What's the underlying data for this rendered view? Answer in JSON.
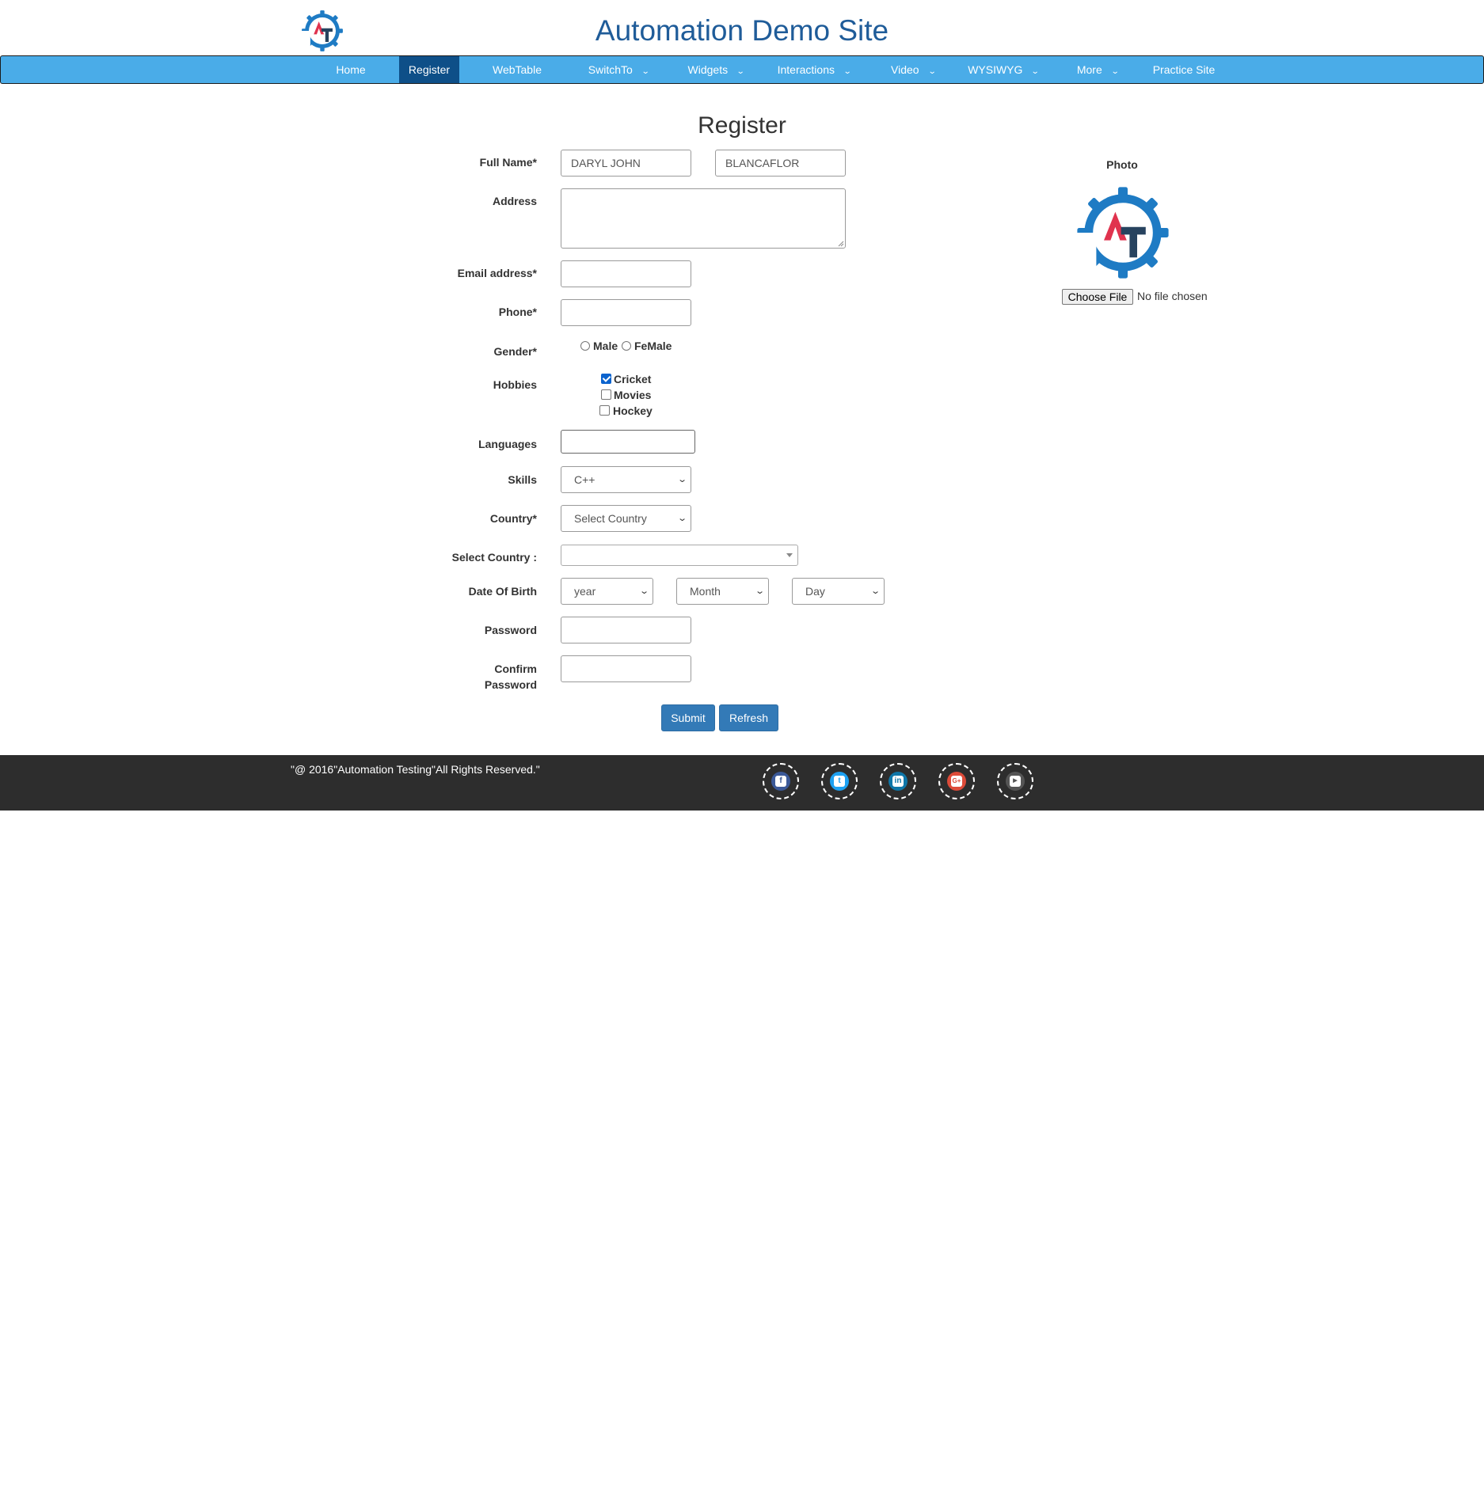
{
  "header": {
    "title": "Automation Demo Site"
  },
  "nav": {
    "items": [
      {
        "label": "Home"
      },
      {
        "label": "Register"
      },
      {
        "label": "WebTable"
      },
      {
        "label": "SwitchTo"
      },
      {
        "label": "Widgets"
      },
      {
        "label": "Interactions"
      },
      {
        "label": "Video"
      },
      {
        "label": "WYSIWYG"
      },
      {
        "label": "More"
      },
      {
        "label": "Practice Site"
      }
    ],
    "active": "Register",
    "colors": {
      "bar": "#4aace8",
      "active": "#0e4f88"
    }
  },
  "form": {
    "heading": "Register",
    "labels": {
      "full_name": "Full Name*",
      "address": "Address",
      "email": "Email address*",
      "phone": "Phone*",
      "gender": "Gender*",
      "hobbies": "Hobbies",
      "languages": "Languages",
      "skills": "Skills",
      "country": "Country*",
      "select_country": "Select Country :",
      "dob": "Date Of Birth",
      "password": "Password",
      "confirm_password_1": "Confirm",
      "confirm_password_2": "Password"
    },
    "first_name": "DARYL JOHN",
    "last_name": "BLANCAFLOR",
    "gender_options": [
      "Male",
      "FeMale"
    ],
    "hobbies": [
      {
        "label": "Cricket",
        "checked": true
      },
      {
        "label": "Movies",
        "checked": false
      },
      {
        "label": "Hockey",
        "checked": false
      }
    ],
    "skills_value": "C++",
    "country_value": "Select Country",
    "dob": {
      "year": "year",
      "month": "Month",
      "day": "Day"
    },
    "buttons": {
      "submit": "Submit",
      "refresh": "Refresh"
    }
  },
  "photo": {
    "label": "Photo",
    "file_button": "Choose File",
    "file_status": "No file chosen"
  },
  "footer": {
    "copyright": "\"@ 2016\"Automation Testing\"All Rights Reserved.\"",
    "social": [
      {
        "icon": "facebook-icon",
        "color": "#3b5998"
      },
      {
        "icon": "twitter-icon",
        "color": "#1da1f2"
      },
      {
        "icon": "linkedin-icon",
        "color": "#0e76a8"
      },
      {
        "icon": "google-plus-icon",
        "color": "#dd4b39"
      },
      {
        "icon": "youtube-icon",
        "color": "#555555"
      }
    ]
  }
}
